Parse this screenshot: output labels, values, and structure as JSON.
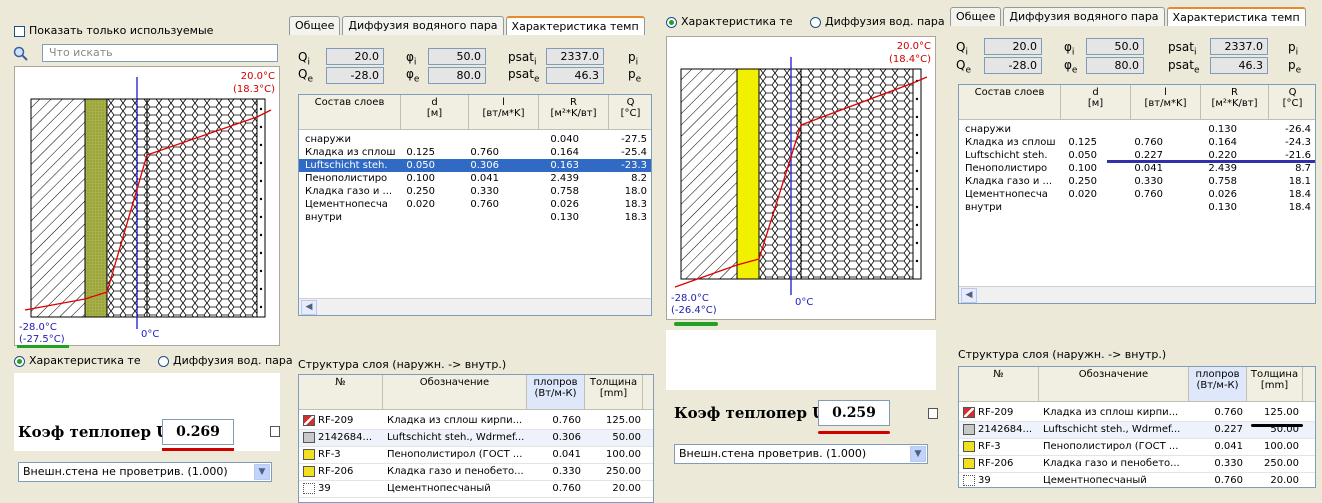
{
  "left": {
    "show_used_label": "Показать только используемые",
    "search_placeholder": "Что искать",
    "tabs": [
      "Общее",
      "Диффузия водяного пара",
      "Характеристика темп"
    ],
    "params": {
      "qi_label": "Q",
      "qi_sub": "i",
      "qi": "20.0",
      "qe_label": "Q",
      "qe_sub": "e",
      "qe": "-28.0",
      "phii_label": "φ",
      "phii_sub": "i",
      "phii": "50.0",
      "phie_label": "φ",
      "phie_sub": "e",
      "phie": "80.0",
      "psat_label": "psat",
      "psati_sub": "i",
      "psati": "2337.0",
      "psate_sub": "e",
      "psate": "46.3",
      "p_label": "p",
      "pi_sub": "i",
      "pe_sub": "e"
    },
    "chart": {
      "top_temp": "20.0°C",
      "top_temp2": "(18.3°C)",
      "bottom_temp": "-28.0°C",
      "bottom_temp2": "(-27.5°C)",
      "zero": "0°C"
    },
    "radio1": "Характеристика те",
    "radio2": "Диффузия вод. пара",
    "u_label": "Коэф теплопер U",
    "u_value": "0.269",
    "wall_select": "Внешн.стена не проветрив. (1.000)",
    "layers_grid": {
      "headers": [
        "Состав слоев",
        "d\n[м]",
        "l\n[вт/м*K]",
        "R\n[м²*K/вт]",
        "Q\n[°C]"
      ],
      "rows": [
        [
          "снаружи",
          "",
          "",
          "0.040",
          "-27.5"
        ],
        [
          "Кладка из сплош",
          "0.125",
          "0.760",
          "0.164",
          "-25.4"
        ],
        [
          "Luftschicht steh.",
          "0.050",
          "0.306",
          "0.163",
          "-23.3"
        ],
        [
          "Пенополистиро",
          "0.100",
          "0.041",
          "2.439",
          "8.2"
        ],
        [
          "Кладка газо и ...",
          "0.250",
          "0.330",
          "0.758",
          "18.0"
        ],
        [
          "Цементнопесча",
          "0.020",
          "0.760",
          "0.026",
          "18.3"
        ],
        [
          "внутри",
          "",
          "",
          "0.130",
          "18.3"
        ]
      ]
    },
    "struct_title": "Структура слоя (наружн. -> внутр.)",
    "struct_grid": {
      "headers": [
        "№",
        "Обозначение",
        "плопров\n(Вт/м-К)",
        "Толщина\n[mm]"
      ],
      "rows": [
        [
          "RF-209",
          "Кладка из сплош кирпи...",
          "0.760",
          "125.00"
        ],
        [
          "2142684...",
          "Luftschicht steh., Wdrmef...",
          "0.306",
          "50.00"
        ],
        [
          "RF-3",
          "Пенополистирол (ГОСТ ...",
          "0.041",
          "100.00"
        ],
        [
          "RF-206",
          "Кладка газо и пенобето...",
          "0.330",
          "250.00"
        ],
        [
          "39",
          "Цементнопесчаный",
          "0.760",
          "20.00"
        ]
      ]
    }
  },
  "right": {
    "radio1": "Характеристика те",
    "radio2": "Диффузия вод. пара",
    "tabs": [
      "Общее",
      "Диффузия водяного пара",
      "Характеристика темп"
    ],
    "params": {
      "qi": "20.0",
      "qe": "-28.0",
      "phii": "50.0",
      "phie": "80.0",
      "psati": "2337.0",
      "psate": "46.3"
    },
    "chart": {
      "top_temp": "20.0°C",
      "top_temp2": "(18.4°C)",
      "bottom_temp": "-28.0°C",
      "bottom_temp2": "(-26.4°C)",
      "zero": "0°C"
    },
    "u_label": "Коэф теплопер U",
    "u_value": "0.259",
    "wall_select": "Внешн.стена проветрив. (1.000)",
    "layers_grid": {
      "headers": [
        "Состав слоев",
        "d\n[м]",
        "l\n[вт/м*K]",
        "R\n[м²*K/вт]",
        "Q\n[°C]"
      ],
      "rows": [
        [
          "снаружи",
          "",
          "",
          "0.130",
          "-26.4"
        ],
        [
          "Кладка из сплош",
          "0.125",
          "0.760",
          "0.164",
          "-24.3"
        ],
        [
          "Luftschicht steh.",
          "0.050",
          "0.227",
          "0.220",
          "-21.6"
        ],
        [
          "Пенополистиро",
          "0.100",
          "0.041",
          "2.439",
          "8.7"
        ],
        [
          "Кладка газо и ...",
          "0.250",
          "0.330",
          "0.758",
          "18.1"
        ],
        [
          "Цементнопесча",
          "0.020",
          "0.760",
          "0.026",
          "18.4"
        ],
        [
          "внутри",
          "",
          "",
          "0.130",
          "18.4"
        ]
      ]
    },
    "struct_title": "Структура слоя (наружн. -> внутр.)",
    "struct_grid": {
      "headers": [
        "№",
        "Обозначение",
        "плопров\n(Вт/м-К)",
        "Толщина\n[mm]"
      ],
      "rows": [
        [
          "RF-209",
          "Кладка из сплош кирпи...",
          "0.760",
          "125.00"
        ],
        [
          "2142684...",
          "Luftschicht steh., Wdrmef...",
          "0.227",
          "50.00"
        ],
        [
          "RF-3",
          "Пенополистирол (ГОСТ ...",
          "0.041",
          "100.00"
        ],
        [
          "RF-206",
          "Кладка газо и пенобето...",
          "0.330",
          "250.00"
        ],
        [
          "39",
          "Цементнопесчаный",
          "0.760",
          "20.00"
        ]
      ]
    }
  },
  "colors": {
    "selection": "#316ac5",
    "red_line": "#e00000",
    "blue_line": "#1a1acc",
    "yellow_layer": "#f0f000",
    "olive_layer": "#a8b048"
  }
}
